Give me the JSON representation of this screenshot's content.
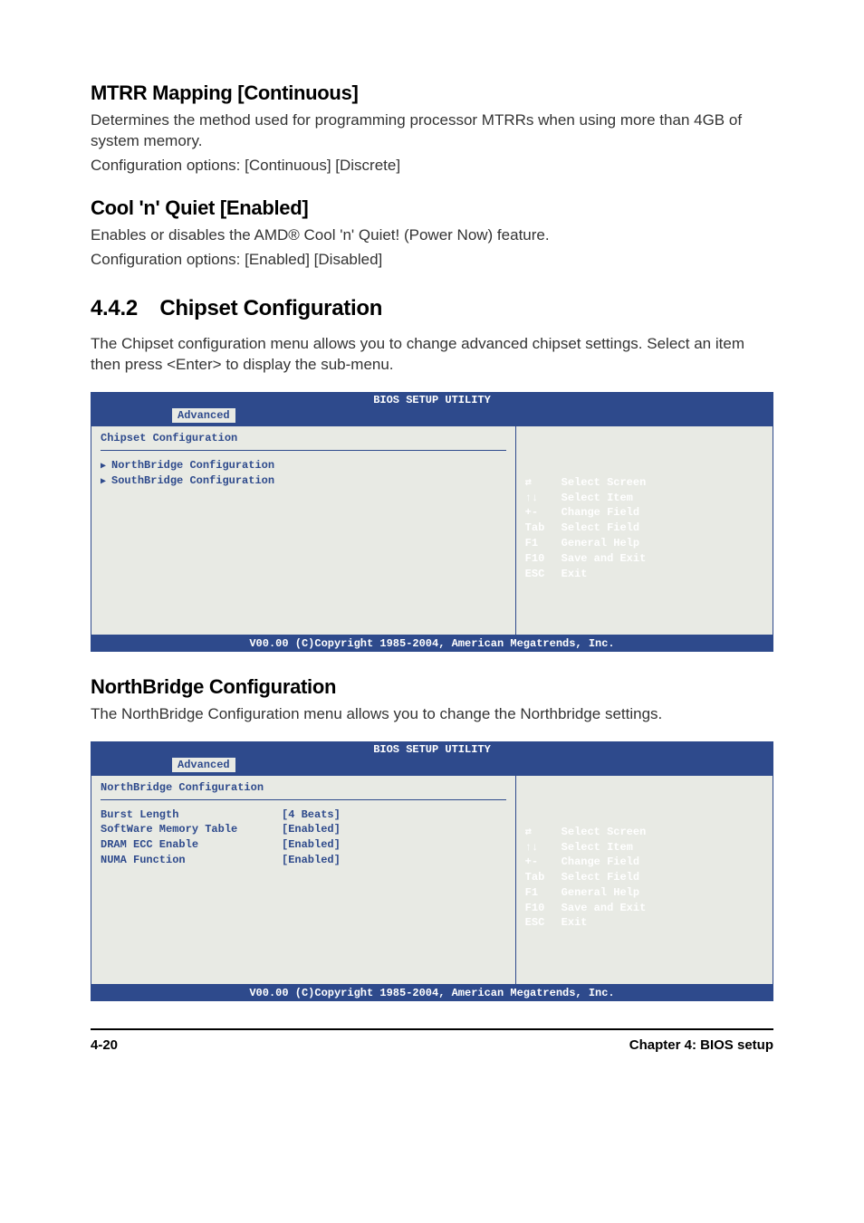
{
  "mtrr": {
    "heading": "MTRR Mapping [Continuous]",
    "line1": "Determines the method used for programming processor MTRRs when using more than 4GB of system memory.",
    "line2": "Configuration options: [Continuous] [Discrete]"
  },
  "cool": {
    "heading": "Cool 'n' Quiet [Enabled]",
    "line1": "Enables or disables the AMD® Cool 'n' Quiet! (Power Now) feature.",
    "line2": "Configuration options: [Enabled] [Disabled]"
  },
  "chipset": {
    "number": "4.4.2",
    "heading": "Chipset Configuration",
    "line1": "The Chipset configuration menu allows you to change advanced chipset settings. Select an item then press <Enter> to display the sub-menu."
  },
  "bios1": {
    "header": "BIOS SETUP UTILITY",
    "tab": "Advanced",
    "title": "Chipset Configuration",
    "items": [
      "NorthBridge Configuration",
      "SouthBridge Configuration"
    ],
    "help": [
      {
        "key": "⇄",
        "desc": "Select Screen"
      },
      {
        "key": "↑↓",
        "desc": "Select Item"
      },
      {
        "key": "+-",
        "desc": "Change Field"
      },
      {
        "key": "Tab",
        "desc": "Select Field"
      },
      {
        "key": "F1",
        "desc": "General Help"
      },
      {
        "key": "F10",
        "desc": "Save and Exit"
      },
      {
        "key": "ESC",
        "desc": "Exit"
      }
    ],
    "footer": "V00.00 (C)Copyright 1985-2004, American Megatrends, Inc."
  },
  "northbridge": {
    "heading": "NorthBridge Configuration",
    "line1": "The NorthBridge Configuration menu allows you to change the Northbridge settings."
  },
  "bios2": {
    "header": "BIOS SETUP UTILITY",
    "tab": "Advanced",
    "title": "NorthBridge Configuration",
    "settings": [
      {
        "label": "Burst Length",
        "value": "[4 Beats]"
      },
      {
        "label": "SoftWare Memory Table",
        "value": "[Enabled]"
      },
      {
        "label": "DRAM ECC Enable",
        "value": "[Enabled]"
      },
      {
        "label": "NUMA Function",
        "value": "[Enabled]"
      }
    ],
    "help": [
      {
        "key": "⇄",
        "desc": "Select Screen"
      },
      {
        "key": "↑↓",
        "desc": "Select Item"
      },
      {
        "key": "+-",
        "desc": "Change Field"
      },
      {
        "key": "Tab",
        "desc": "Select Field"
      },
      {
        "key": "F1",
        "desc": "General Help"
      },
      {
        "key": "F10",
        "desc": "Save and Exit"
      },
      {
        "key": "ESC",
        "desc": "Exit"
      }
    ],
    "footer": "V00.00 (C)Copyright 1985-2004, American Megatrends, Inc."
  },
  "footer": {
    "left": "4-20",
    "right": "Chapter 4: BIOS setup"
  }
}
